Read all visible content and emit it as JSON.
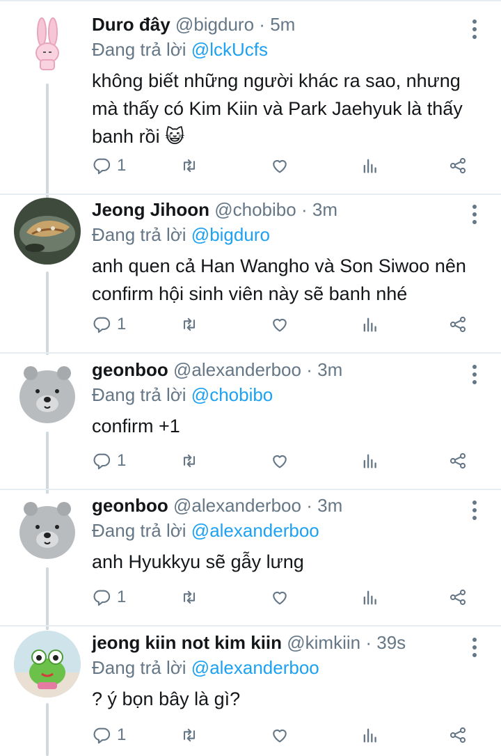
{
  "tweets": [
    {
      "name": "Duro đây",
      "handle": "@bigduro",
      "separator": "·",
      "time": "5m",
      "reply_prefix": "Đang trả lời",
      "reply_to": "@lckUcfs",
      "text": "không biết những người khác ra sao, nhưng mà thấy có Kim Kiin và Park Jaehyuk là thấy banh rồi 😺",
      "reply_count": "1",
      "avatar_icon": "bunny-avatar-icon"
    },
    {
      "name": "Jeong Jihoon",
      "handle": "@chobibo",
      "separator": "·",
      "time": "3m",
      "reply_prefix": "Đang trả lời",
      "reply_to": "@bigduro",
      "text": "anh quen cả Han Wangho và Son Siwoo nên confirm hội sinh viên này sẽ banh nhé",
      "reply_count": "1",
      "avatar_icon": "food-plate-avatar-icon"
    },
    {
      "name": "geonboo",
      "handle": "@alexanderboo",
      "separator": "·",
      "time": "3m",
      "reply_prefix": "Đang trả lời",
      "reply_to": "@chobibo",
      "text": "confirm +1",
      "reply_count": "1",
      "avatar_icon": "plush-bear-avatar-icon"
    },
    {
      "name": "geonboo",
      "handle": "@alexanderboo",
      "separator": "·",
      "time": "3m",
      "reply_prefix": "Đang trả lời",
      "reply_to": "@alexanderboo",
      "text": "anh Hyukkyu sẽ gẫy lưng",
      "reply_count": "1",
      "avatar_icon": "plush-bear-avatar-icon"
    },
    {
      "name": "jeong kiin not kim kiin",
      "handle": "@kimkiin",
      "separator": "·",
      "time": "39s",
      "reply_prefix": "Đang trả lời",
      "reply_to": "@alexanderboo",
      "text": "? ý bọn bây là gì?",
      "reply_count": "1",
      "avatar_icon": "frog-avatar-icon"
    }
  ],
  "colors": {
    "accent": "#1da1f2",
    "secondary_text": "#657786",
    "primary_text": "#14171a",
    "thread_line": "#cfd9de",
    "divider": "#e6ecf0"
  },
  "icons": {
    "reply": "reply-icon",
    "retweet": "retweet-icon",
    "like": "heart-icon",
    "stats": "stats-icon",
    "share": "share-icon",
    "more": "more-options-icon"
  }
}
